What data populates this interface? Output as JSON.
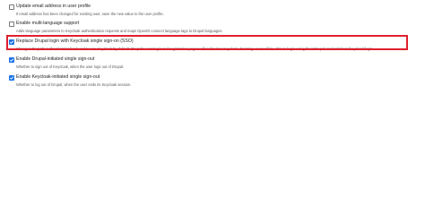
{
  "options": [
    {
      "label": "Update email address in user profile",
      "description": "If email address has been changed for existing user, save the new value to the user profile.",
      "checked": false
    },
    {
      "label": "Enable multi-language support",
      "description": "Adds language parameters to Keycloak authentication requests and maps OpenID connect language tags to Drupal languages.",
      "checked": false
    },
    {
      "label": "Replace Drupal login with Keycloak single sign-on (SSO)",
      "description": "Changes Drupal's authentication back-end to use Keycloak by default. Drupal's user login and registration pages will redirect to Keycloak. Existing users will be able to login using their Drupal credentials at  /keycloak/login.",
      "checked": true,
      "highlighted": true
    },
    {
      "label": "Enable Drupal-initiated single sign-out",
      "description": "Whether to sign out of Keycloak, when the user logs out of Drupal.",
      "checked": true
    },
    {
      "label": "Enable Keycloak-initiated single sign-out",
      "description": "Whether to log out of Drupal, when the user ends its Keycloak session.",
      "checked": true
    }
  ],
  "colors": {
    "highlight_border": "#e0202e",
    "checkbox_checked": "#1a73e8"
  }
}
